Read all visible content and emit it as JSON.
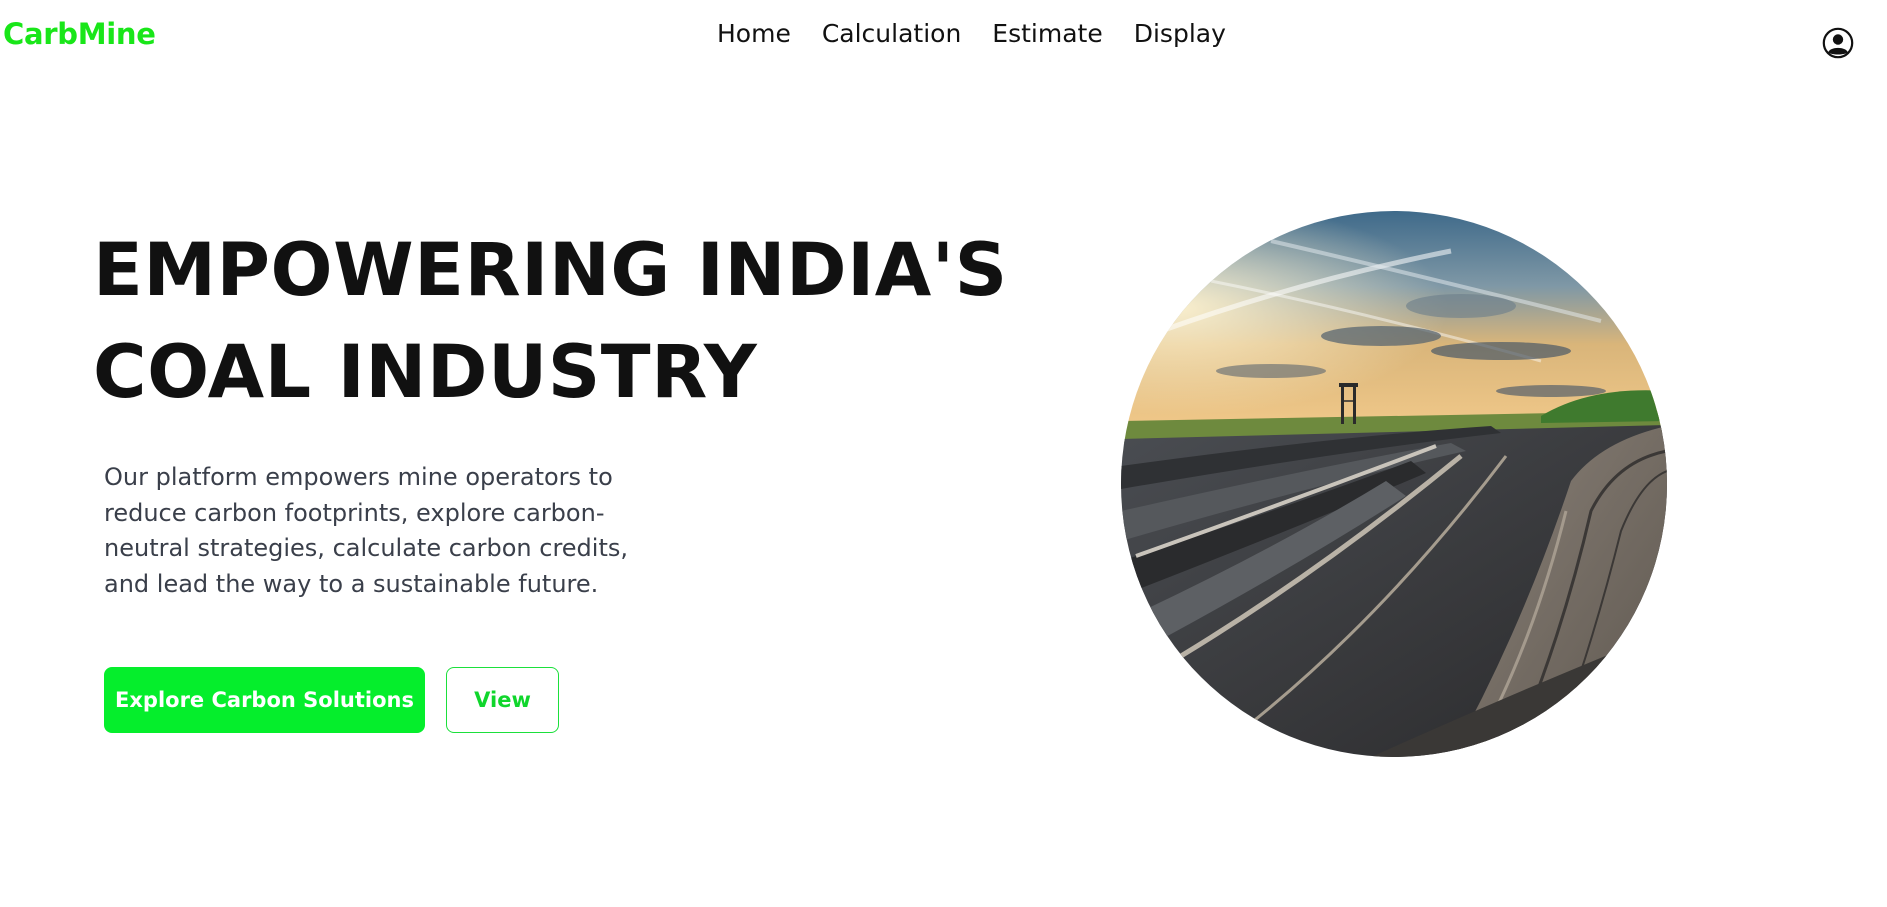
{
  "brand": {
    "name": "CarbMine",
    "color": "#19e619"
  },
  "nav": {
    "items": [
      {
        "label": "Home"
      },
      {
        "label": "Calculation"
      },
      {
        "label": "Estimate"
      },
      {
        "label": "Display"
      }
    ]
  },
  "profile": {
    "icon": "user-circle-icon"
  },
  "hero": {
    "title_line1": "EMPOWERING INDIA'S",
    "title_line2": "COAL INDUSTRY",
    "description": "Our platform empowers mine operators to reduce carbon footprints, explore carbon-neutral strategies, calculate carbon credits, and lead the way to a sustainable future.",
    "primary_button": "Explore Carbon Solutions",
    "secondary_button": "View",
    "accent_color": "#05ee2c",
    "image": "open-pit-coal-mine-photo"
  }
}
